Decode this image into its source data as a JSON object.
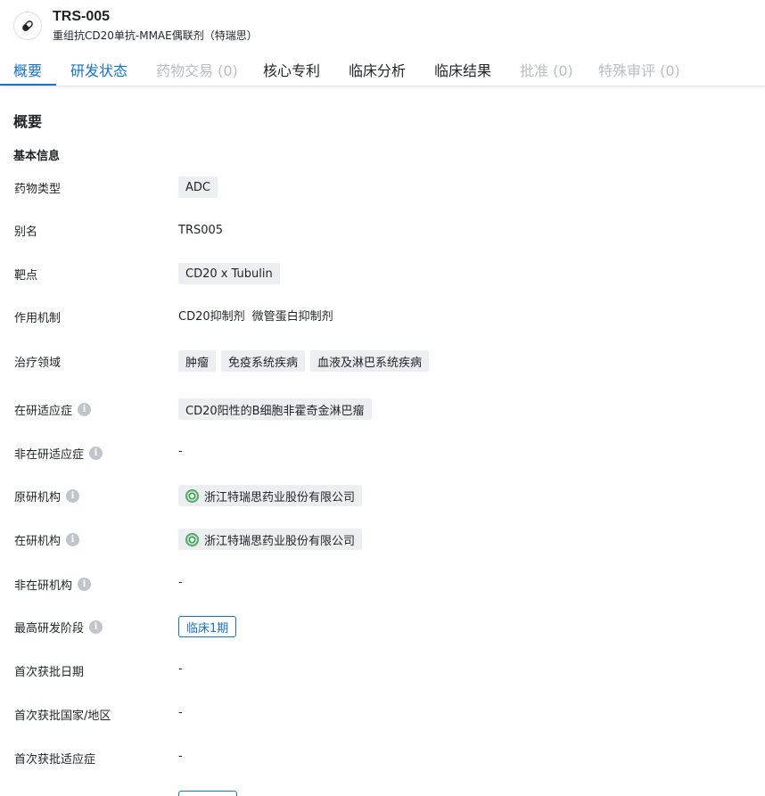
{
  "header": {
    "title": "TRS-005",
    "subtitle": "重组抗CD20单抗-MMAE偶联剂（特瑞思）",
    "icon": "pill-icon"
  },
  "tabs": [
    {
      "label": "概要",
      "state": "active"
    },
    {
      "label": "研发状态",
      "state": "link"
    },
    {
      "label": "药物交易 (0)",
      "state": "disabled"
    },
    {
      "label": "核心专利",
      "state": "normal"
    },
    {
      "label": "临床分析",
      "state": "normal"
    },
    {
      "label": "临床结果",
      "state": "normal"
    },
    {
      "label": "批准 (0)",
      "state": "disabled"
    },
    {
      "label": "特殊审评 (0)",
      "state": "disabled"
    }
  ],
  "overview": {
    "section_title": "概要",
    "group_title": "基本信息",
    "fields": {
      "drug_type": {
        "label": "药物类型",
        "tags": [
          "ADC"
        ]
      },
      "alias": {
        "label": "别名",
        "value": "TRS005"
      },
      "target": {
        "label": "靶点",
        "tags": [
          "CD20 x Tubulin"
        ]
      },
      "mechanism": {
        "label": "作用机制",
        "items": [
          "CD20抑制剂",
          "微管蛋白抑制剂"
        ]
      },
      "therapeutic_area": {
        "label": "治疗领域",
        "tags": [
          "肿瘤",
          "免疫系统疾病",
          "血液及淋巴系统疾病"
        ]
      },
      "active_indication": {
        "label": "在研适应症",
        "tags": [
          "CD20阳性的B细胞非霍奇金淋巴瘤"
        ]
      },
      "inactive_indication": {
        "label": "非在研适应症",
        "value": "-"
      },
      "originator": {
        "label": "原研机构",
        "org": "浙江特瑞思药业股份有限公司"
      },
      "active_org": {
        "label": "在研机构",
        "org": "浙江特瑞思药业股份有限公司"
      },
      "inactive_org": {
        "label": "非在研机构",
        "value": "-"
      },
      "highest_phase": {
        "label": "最高研发阶段",
        "stage": "临床1期"
      },
      "first_approval_date": {
        "label": "首次获批日期",
        "value": "-"
      },
      "first_approval_country": {
        "label": "首次获批国家/地区",
        "value": "-"
      },
      "first_approval_indication": {
        "label": "首次获批适应症",
        "value": "-"
      }
    }
  },
  "colors": {
    "accent": "#1a6fc9",
    "tag_bg": "#eceef1",
    "disabled_text": "#b8bcc4"
  }
}
